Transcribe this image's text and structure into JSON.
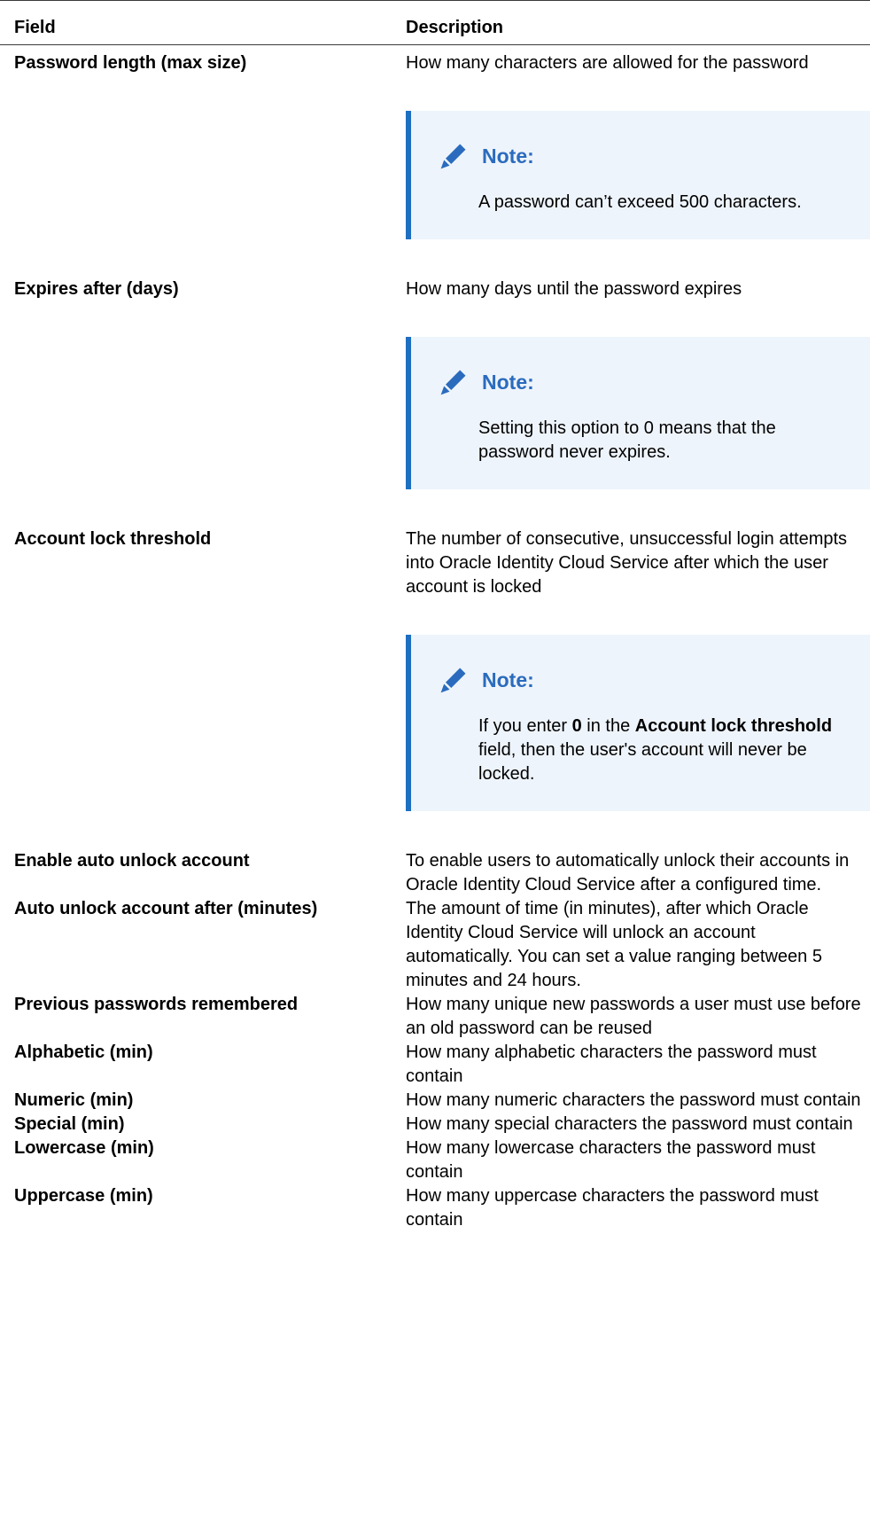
{
  "table": {
    "headers": {
      "field": "Field",
      "description": "Description"
    },
    "rows": [
      {
        "field": "Password length (max size)",
        "description": "How many characters are allowed for the password",
        "note": {
          "title": "Note:",
          "body": "A password can’t exceed 500 characters."
        }
      },
      {
        "field": "Expires after (days)",
        "description": "How many days until the password expires",
        "note": {
          "title": "Note:",
          "body": "Setting this option to 0 means that the password never expires."
        }
      },
      {
        "field": "Account lock threshold",
        "description": "The number of consecutive, unsuccessful login attempts into Oracle Identity Cloud Service after which the user account is locked",
        "note": {
          "title": "Note:",
          "body_parts": [
            "If you enter ",
            "0",
            " in the ",
            "Account lock threshold",
            " field, then the user's account will never be locked."
          ]
        }
      },
      {
        "field": "Enable auto unlock account",
        "description": "To enable users to automatically unlock their accounts in Oracle Identity Cloud Service after a configured time."
      },
      {
        "field": "Auto unlock account after (minutes)",
        "description": "The amount of time (in minutes), after which Oracle Identity Cloud Service will unlock an account automatically. You can set a value ranging between 5 minutes and 24 hours."
      },
      {
        "field": "Previous passwords remembered",
        "description": "How many unique new passwords a user must use before an old password can be reused"
      },
      {
        "field": "Alphabetic (min)",
        "description": "How many alphabetic characters the password must contain"
      },
      {
        "field": "Numeric (min)",
        "description": "How many numeric characters the password must contain"
      },
      {
        "field": "Special (min)",
        "description": "How many special characters the password must contain"
      },
      {
        "field": "Lowercase (min)",
        "description": "How many lowercase characters the password must contain"
      },
      {
        "field": "Uppercase (min)",
        "description": "How many uppercase characters the password must contain"
      }
    ]
  },
  "icons": {
    "note": "pencil-icon"
  },
  "colors": {
    "note_accent": "#1e6fc1",
    "note_title": "#2a6bbe",
    "note_background": "#eef4fb",
    "rule": "#3a3a3a"
  }
}
